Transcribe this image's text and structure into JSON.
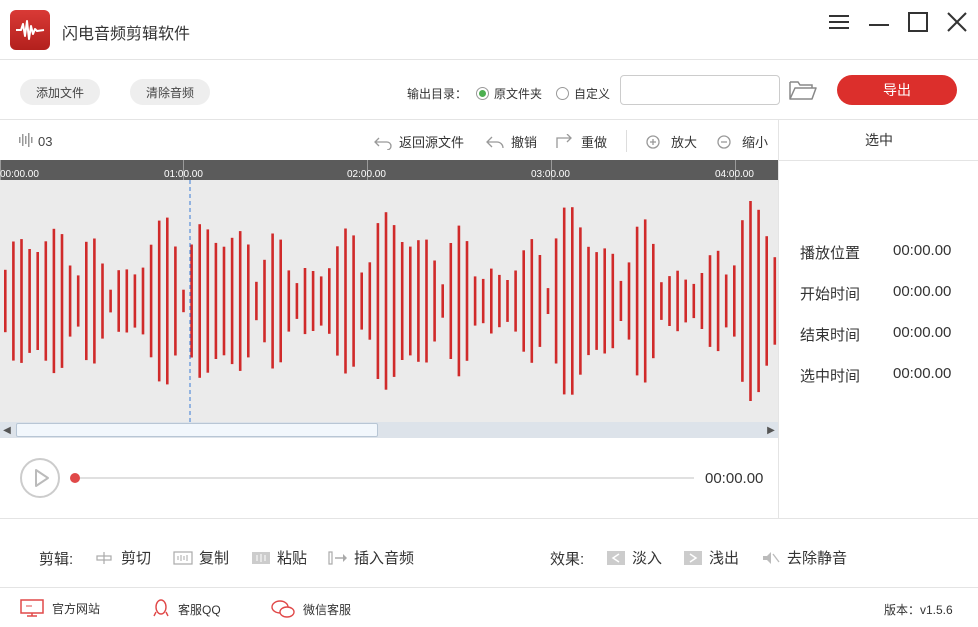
{
  "app": {
    "title": "闪电音频剪辑软件"
  },
  "toolbar": {
    "add_file": "添加文件",
    "clear_audio": "清除音频",
    "output_label": "输出目录：",
    "radio_source": "原文件夹",
    "radio_custom": "自定义",
    "output_path": "",
    "export": "导出"
  },
  "editor": {
    "track_name": "03",
    "tools": {
      "revert": "返回源文件",
      "undo": "撤销",
      "redo": "重做",
      "zoom_in": "放大",
      "zoom_out": "缩小"
    },
    "ruler_labels": [
      "00:00.00",
      "01:00.00",
      "02:00.00",
      "03:00.00",
      "04:00.00"
    ]
  },
  "panel": {
    "title": "选中",
    "rows": [
      {
        "label": "播放位置",
        "value": "00:00.00"
      },
      {
        "label": "开始时间",
        "value": "00:00.00"
      },
      {
        "label": "结束时间",
        "value": "00:00.00"
      },
      {
        "label": "选中时间",
        "value": "00:00.00"
      }
    ]
  },
  "player": {
    "current_time": "00:00.00",
    "progress": 0
  },
  "edit_bar": {
    "edit_label": "剪辑:",
    "cut": "剪切",
    "copy": "复制",
    "paste": "粘贴",
    "insert_audio": "插入音频",
    "effect_label": "效果:",
    "fade_in": "淡入",
    "fade_out": "浅出",
    "remove_silence": "去除静音"
  },
  "footer": {
    "website": "官方网站",
    "qq": "客服QQ",
    "wechat": "微信客服",
    "version": "版本：v1.5.6"
  },
  "colors": {
    "accent": "#dc2f2c",
    "waveform": "#d02a2a",
    "radio_on": "#4caf50"
  },
  "icons": {
    "logo": "waveform-logo-icon",
    "menu": "menu-icon",
    "minimize": "minimize-icon",
    "maximize": "maximize-icon",
    "close": "close-icon",
    "folder": "folder-open-icon",
    "play": "play-icon"
  }
}
